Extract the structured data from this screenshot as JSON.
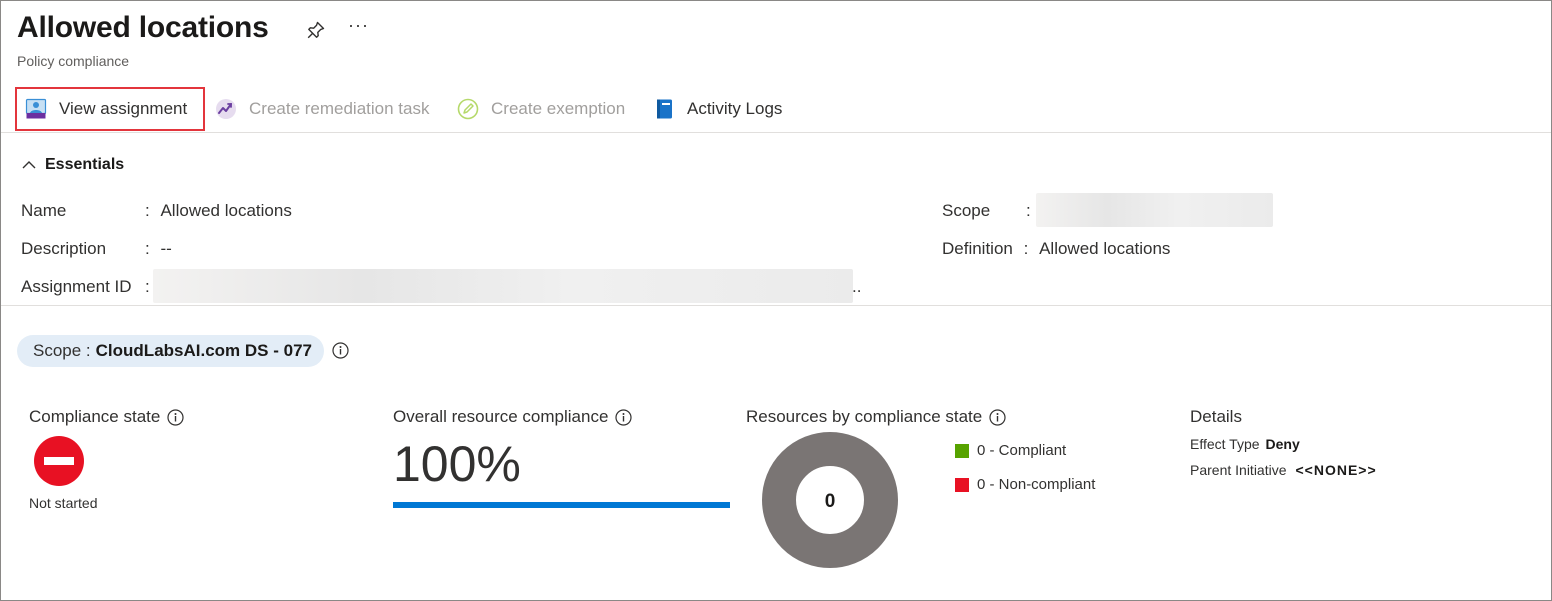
{
  "header": {
    "title": "Allowed locations",
    "subtitle": "Policy compliance",
    "more": "···"
  },
  "toolbar": {
    "view_assignment": "View assignment",
    "create_remediation": "Create remediation task",
    "create_exemption": "Create exemption",
    "activity_logs": "Activity Logs"
  },
  "essentials": {
    "heading": "Essentials",
    "name_label": "Name",
    "name_value": "Allowed locations",
    "description_label": "Description",
    "description_value": "--",
    "assignment_id_label": "Assignment ID",
    "assignment_id_trail": "..",
    "scope_label": "Scope",
    "definition_label": "Definition",
    "definition_value": "Allowed locations",
    "colon": ":"
  },
  "scope_filter": {
    "label": "Scope :",
    "value": "CloudLabsAI.com DS - 077"
  },
  "compliance_state": {
    "heading": "Compliance state",
    "status": "Not started",
    "status_color": "#e81123"
  },
  "overall": {
    "heading": "Overall resource compliance",
    "percent_label": "100%",
    "percent_value": 100,
    "bar_color": "#0078d4"
  },
  "by_state": {
    "heading": "Resources by compliance state",
    "donut_center": "0",
    "donut_color": "#7a7574",
    "legend": [
      {
        "label": "0 - Compliant",
        "color": "#57a300"
      },
      {
        "label": "0 - Non-compliant",
        "color": "#e81123"
      }
    ]
  },
  "details": {
    "heading": "Details",
    "effect_label": "Effect Type",
    "effect_value": "Deny",
    "parent_label": "Parent Initiative",
    "parent_value": "<<NONE>>"
  },
  "icons": {
    "pin": "pin-icon",
    "view_assignment": "view-assignment-icon",
    "remediation": "remediation-chart-icon",
    "exemption": "exemption-pencil-icon",
    "activity_logs": "activity-log-book-icon",
    "info": "info-icon",
    "collapse": "chevron-up-icon",
    "blocked": "blocked-status-icon"
  }
}
